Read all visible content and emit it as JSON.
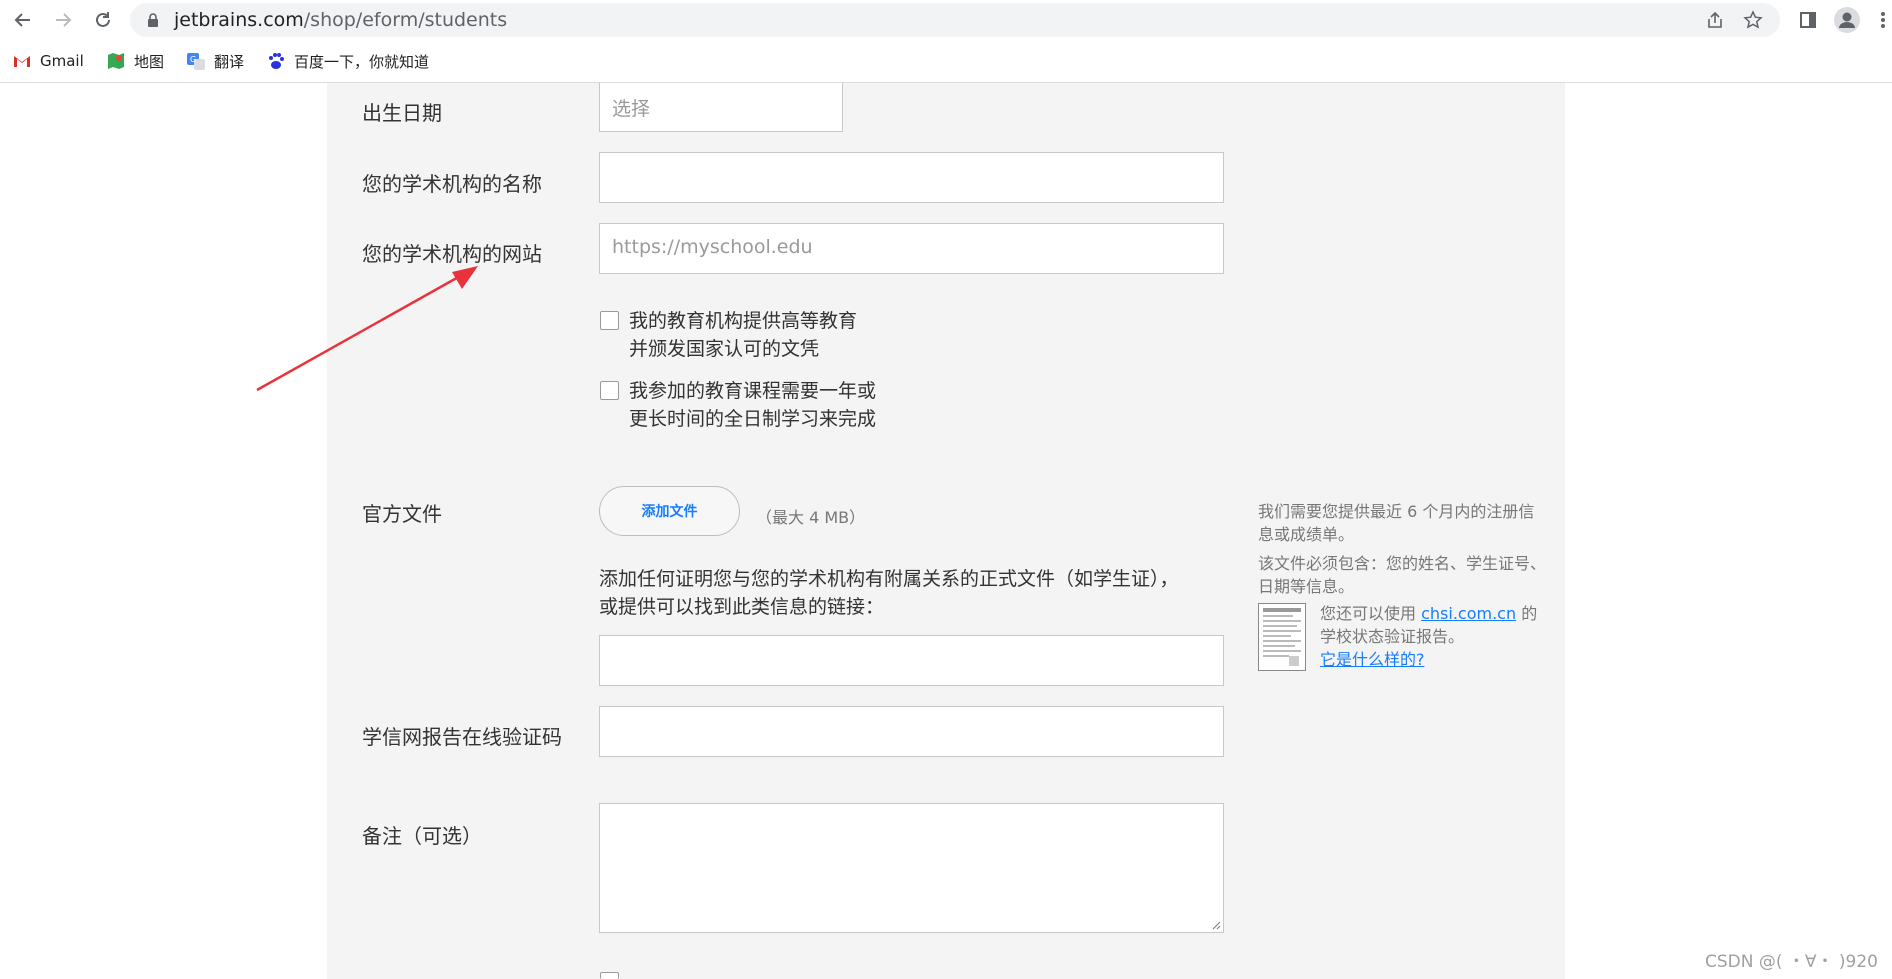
{
  "browser": {
    "url_host": "jetbrains.com",
    "url_path": "/shop/eform/students",
    "bookmarks": [
      {
        "label": "Gmail",
        "icon": "gmail-icon"
      },
      {
        "label": "地图",
        "icon": "maps-icon"
      },
      {
        "label": "翻译",
        "icon": "translate-icon"
      },
      {
        "label": "百度一下，你就知道",
        "icon": "baidu-icon"
      }
    ]
  },
  "form": {
    "birth_date_label": "出生日期",
    "birth_date_placeholder": "选择",
    "institution_name_label": "您的学术机构的名称",
    "institution_website_label": "您的学术机构的网站",
    "institution_website_placeholder": "https://myschool.edu",
    "checkbox_higher_ed_line1": "我的教育机构提供高等教育",
    "checkbox_higher_ed_line2": "并颁发国家认可的文凭",
    "checkbox_fulltime_line1": "我参加的教育课程需要一年或",
    "checkbox_fulltime_line2": "更长时间的全日制学习来完成",
    "official_doc_label": "官方文件",
    "add_file_button": "添加文件",
    "max_size": "（最大 4 MB）",
    "doc_description": "添加任何证明您与您的学术机构有附属关系的正式文件（如学生证），或提供可以找到此类信息的链接：",
    "chsi_code_label": "学信网报告在线验证码",
    "notes_label": "备注（可选）"
  },
  "sidebar_info": {
    "line1": "我们需要您提供最近 6 个月内的注册信息或成绩单。",
    "line2": "该文件必须包含：您的姓名、学生证号、日期等信息。",
    "chsi_prefix": "您还可以使用",
    "chsi_link": "chsi.com.cn",
    "chsi_suffix": "的学校状态验证报告。",
    "what_link": "它是什么样的?"
  },
  "watermark": "CSDN @( ・∀・ )920",
  "colors": {
    "accent_blue": "#167dff",
    "arrow_red": "#e8323c",
    "panel_bg": "#f4f4f4"
  }
}
